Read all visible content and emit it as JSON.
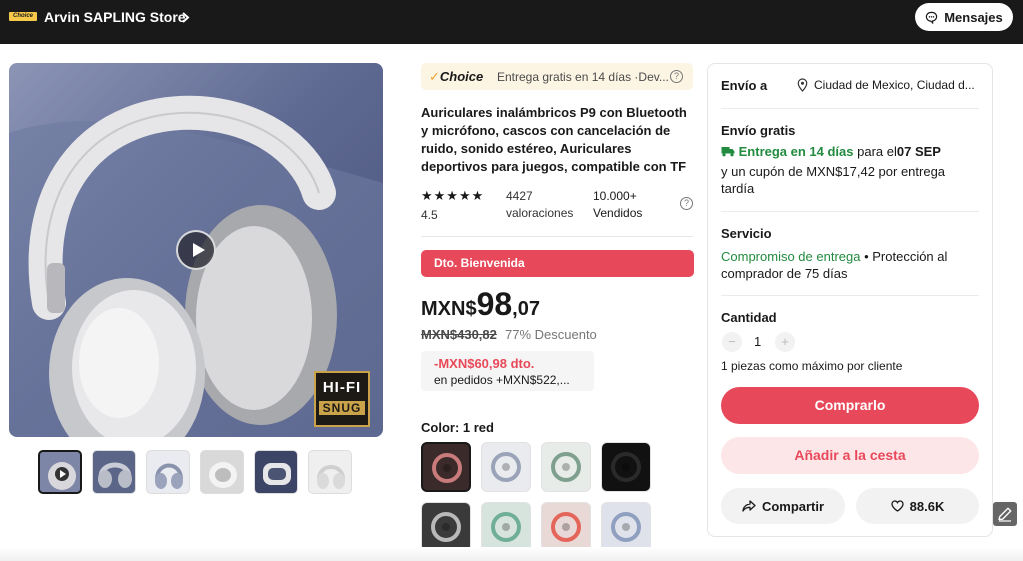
{
  "header": {
    "choice_badge": "Choice",
    "store_name": "Arvin SAPLING Store",
    "messages_label": "Mensajes"
  },
  "gallery": {
    "badge_line1": "HI-FI",
    "badge_line2": "SNUG",
    "thumbnail_count": 6
  },
  "product": {
    "choice_mark": "Choice",
    "choice_delivery": "Entrega gratis en 14 días ·Dev...",
    "title": "Auriculares inalámbricos P9 con Bluetooth y micrófono, cascos con cancelación de ruido, sonido estéreo, Auriculares deportivos para juegos, compatible con TF",
    "stars": "★★★★★",
    "rating": "4.5",
    "reviews_count": "4427",
    "reviews_label": "valoraciones",
    "sold_count": "10.000+",
    "sold_label": "Vendidos",
    "welcome_banner": "Dto. Bienvenida",
    "price_currency": "MXN$",
    "price_integer": "98",
    "price_decimal": ",07",
    "original_price": "MXN$430,82",
    "discount": "77% Descuento",
    "coupon_amount": "-MXN$60,98 dto.",
    "coupon_condition": "en pedidos +MXN$522,...",
    "color_label": "Color: 1 red",
    "swatches": [
      {
        "rim": "#c97a7a",
        "bg": "#3b2a2a"
      },
      {
        "rim": "#9aa3b8",
        "bg": "#e9ebef"
      },
      {
        "rim": "#7f9f8f",
        "bg": "#e7ece8"
      },
      {
        "rim": "#2a2a2a",
        "bg": "#111111"
      },
      {
        "rim": "#b9b9b9",
        "bg": "#3a3a3a"
      },
      {
        "rim": "#6fae97",
        "bg": "#d7e3dd"
      },
      {
        "rim": "#e4655a",
        "bg": "#e8d8d6"
      },
      {
        "rim": "#8f9fc0",
        "bg": "#dfe2ea"
      }
    ]
  },
  "shipping": {
    "ship_to_label": "Envío a",
    "location": "Ciudad de Mexico, Ciudad d...",
    "free_shipping_label": "Envío gratis",
    "delivery_text": "Entrega en 14 días",
    "delivery_for": "para el",
    "delivery_date": "07 SEP",
    "late_coupon": "y un cupón de MXN$17,42 por entrega tardía",
    "service_label": "Servicio",
    "service_commitment": "Compromiso de entrega",
    "service_protection": " • Protección al comprador de 75 días",
    "quantity_label": "Cantidad",
    "quantity_minus": "−",
    "quantity_value": "1",
    "quantity_plus": "+",
    "max_per_customer": "1 piezas como máximo por cliente",
    "buy_label": "Comprarlo",
    "cart_label": "Añadir a la cesta",
    "share_label": "Compartir",
    "likes": "88.6K"
  },
  "colors": {
    "accent": "#e8495a",
    "green": "#228b3f",
    "header_bg": "#191919"
  }
}
